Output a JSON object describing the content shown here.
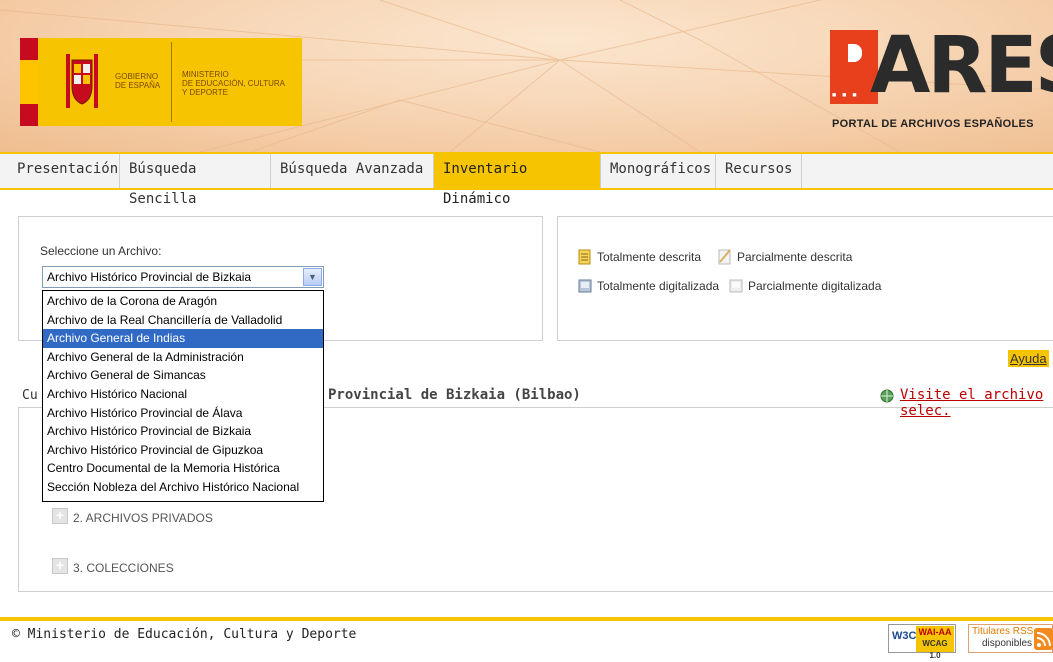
{
  "header": {
    "gov_line1": "GOBIERNO",
    "gov_line2": "DE ESPAÑA",
    "ministry_line1": "MINISTERIO",
    "ministry_line2": "DE EDUCACIÓN, CULTURA",
    "ministry_line3": "Y DEPORTE",
    "pares_logo": "ARES",
    "pares_subtitle": "PORTAL DE ARCHIVOS ESPAÑOLES",
    "accent_color": "#f6c400",
    "pares_red": "#e8401c"
  },
  "nav": {
    "tabs": [
      {
        "label": "Presentación",
        "active": false
      },
      {
        "label": "Búsqueda Sencilla",
        "active": false
      },
      {
        "label": "Búsqueda Avanzada",
        "active": false
      },
      {
        "label": "Inventario Dinámico",
        "active": true
      },
      {
        "label": "Monográficos",
        "active": false
      },
      {
        "label": "Recursos",
        "active": false
      }
    ]
  },
  "archive_select": {
    "label": "Seleccione un Archivo:",
    "selected_value": "Archivo Histórico Provincial de Bizkaia",
    "options": [
      {
        "label": "Archivo de la Corona de Aragón",
        "highlighted": false
      },
      {
        "label": "Archivo de la Real Chancillería de Valladolid",
        "highlighted": false
      },
      {
        "label": "Archivo General de Indias",
        "highlighted": true
      },
      {
        "label": "Archivo General de la Administración",
        "highlighted": false
      },
      {
        "label": "Archivo General de Simancas",
        "highlighted": false
      },
      {
        "label": "Archivo Histórico Nacional",
        "highlighted": false
      },
      {
        "label": "Archivo Histórico Provincial de Álava",
        "highlighted": false
      },
      {
        "label": "Archivo Histórico Provincial de Bizkaia",
        "highlighted": false
      },
      {
        "label": "Archivo Histórico Provincial de Gipuzkoa",
        "highlighted": false
      },
      {
        "label": "Centro Documental de la Memoria Histórica",
        "highlighted": false
      },
      {
        "label": "Sección Nobleza del Archivo Histórico Nacional",
        "highlighted": false
      }
    ]
  },
  "legend": {
    "fully_described": "Totalmente descrita",
    "partially_described": "Parcialmente descrita",
    "fully_digitized": "Totalmente digitalizada",
    "partially_digitized": "Parcialmente digitalizada"
  },
  "help_link": "Ayuda",
  "tree": {
    "header_prefix": "Cu",
    "header_title": "Provincial de Bizkaia (Bilbao)",
    "visit_link": "Visite el archivo selec.",
    "items": [
      {
        "label": "2. ARCHIVOS PRIVADOS"
      },
      {
        "label": "3. COLECCIONES"
      }
    ]
  },
  "footer": {
    "copyright": "© Ministerio de Educación, Cultura y Deporte",
    "w3c_label": "W3C",
    "wai_line1": "WAI-AA",
    "wai_line2": "WCAG 1.0",
    "rss_line1": "Titulares RSS",
    "rss_line2": "disponibles"
  }
}
